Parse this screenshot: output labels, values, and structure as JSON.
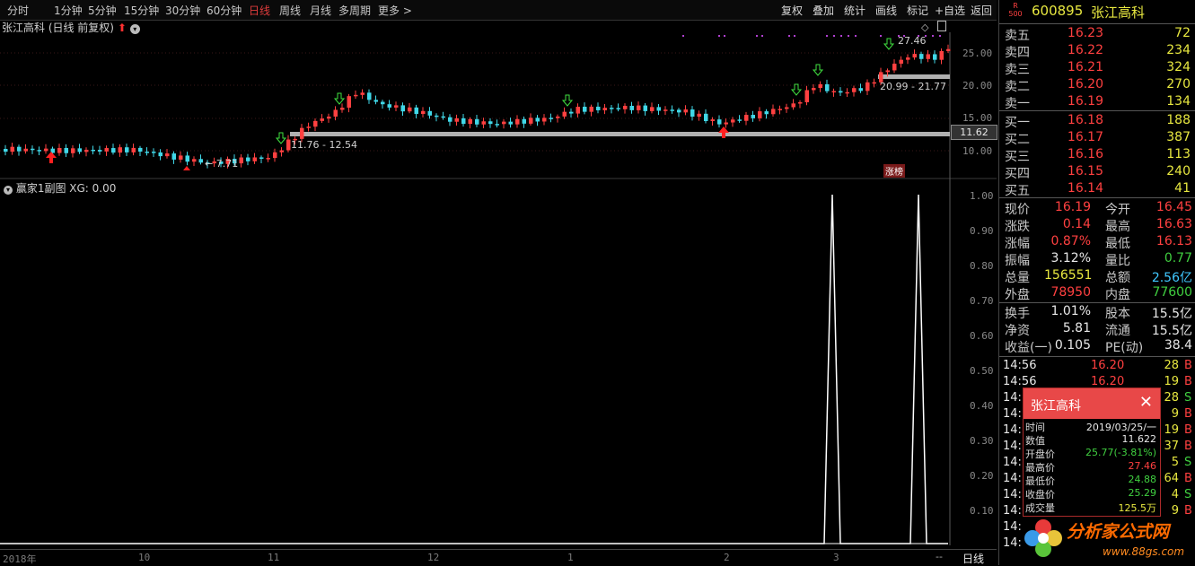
{
  "toolbar": {
    "periods": [
      "分时",
      "1分钟",
      "5分钟",
      "15分钟",
      "30分钟",
      "60分钟",
      "日线",
      "周线",
      "月线",
      "多周期",
      "更多 >"
    ],
    "active_period": "日线",
    "right_buttons": [
      "复权",
      "叠加",
      "统计",
      "画线",
      "标记",
      "+自选",
      "返回"
    ]
  },
  "chart": {
    "title": "张江高科 (日线 前复权)",
    "price_axis": [
      "25.00",
      "20.00",
      "15.00",
      "10.00"
    ],
    "current_price_tag": "11.62",
    "annotations": {
      "high_label": "27.46",
      "low_label": "7.71",
      "range1": "11.76 - 12.54",
      "range2": "20.99 - 21.77",
      "badge": "涨榜"
    },
    "sub_title": "赢家1副图  XG: 0.00",
    "sub_axis": [
      "1.00",
      "0.90",
      "0.80",
      "0.70",
      "0.60",
      "0.50",
      "0.40",
      "0.30",
      "0.20",
      "0.10"
    ],
    "time_axis": [
      "2018年",
      "10",
      "11",
      "12",
      "1",
      "2",
      "3"
    ],
    "period_label": "日线",
    "scroll_glyph": "--"
  },
  "chart_data": {
    "type": "line",
    "title": "",
    "series": [
      {
        "name": "XG",
        "x_fraction": [
          0.0,
          0.96,
          0.965,
          0.975,
          0.985,
          0.995,
          1.0
        ],
        "values": [
          0,
          0,
          1,
          0,
          0,
          1,
          0
        ]
      }
    ],
    "ylim": [
      0,
      1.0
    ]
  },
  "quote": {
    "code": "600895",
    "name": "张江高科",
    "badge_top": "R",
    "badge_bottom": "500",
    "asks": [
      {
        "label": "卖五",
        "price": "16.23",
        "vol": "72"
      },
      {
        "label": "卖四",
        "price": "16.22",
        "vol": "234"
      },
      {
        "label": "卖三",
        "price": "16.21",
        "vol": "324"
      },
      {
        "label": "卖二",
        "price": "16.20",
        "vol": "270"
      },
      {
        "label": "卖一",
        "price": "16.19",
        "vol": "134"
      }
    ],
    "bids": [
      {
        "label": "买一",
        "price": "16.18",
        "vol": "188"
      },
      {
        "label": "买二",
        "price": "16.17",
        "vol": "387"
      },
      {
        "label": "买三",
        "price": "16.16",
        "vol": "113"
      },
      {
        "label": "买四",
        "price": "16.15",
        "vol": "240"
      },
      {
        "label": "买五",
        "price": "16.14",
        "vol": "41"
      }
    ],
    "stats": [
      {
        "k1": "现价",
        "v1": "16.19",
        "c1": "red",
        "k2": "今开",
        "v2": "16.45",
        "c2": "red"
      },
      {
        "k1": "涨跌",
        "v1": "0.14",
        "c1": "red",
        "k2": "最高",
        "v2": "16.63",
        "c2": "red"
      },
      {
        "k1": "涨幅",
        "v1": "0.87%",
        "c1": "red",
        "k2": "最低",
        "v2": "16.13",
        "c2": "red"
      },
      {
        "k1": "振幅",
        "v1": "3.12%",
        "c1": "white",
        "k2": "量比",
        "v2": "0.77",
        "c2": "green"
      },
      {
        "k1": "总量",
        "v1": "156551",
        "c1": "yellow",
        "k2": "总额",
        "v2": "2.56亿",
        "c2": "cyan"
      },
      {
        "k1": "外盘",
        "v1": "78950",
        "c1": "red",
        "k2": "内盘",
        "v2": "77600",
        "c2": "green"
      }
    ],
    "fundamentals": [
      {
        "k1": "换手",
        "v1": "1.01%",
        "k2": "股本",
        "v2": "15.5亿"
      },
      {
        "k1": "净资",
        "v1": "5.81",
        "k2": "流通",
        "v2": "15.5亿"
      },
      {
        "k1": "收益(一)",
        "v1": "0.105",
        "k2": "PE(动)",
        "v2": "38.4"
      }
    ],
    "ticks": [
      {
        "t": "14:56",
        "p": "16.20",
        "v": "28",
        "bs": "B"
      },
      {
        "t": "14:56",
        "p": "16.20",
        "v": "19",
        "bs": "B"
      },
      {
        "t": "14:",
        "p": "",
        "v": "28",
        "bs": "S"
      },
      {
        "t": "14:",
        "p": "",
        "v": "9",
        "bs": "B"
      },
      {
        "t": "14:",
        "p": "",
        "v": "19",
        "bs": "B"
      },
      {
        "t": "14:",
        "p": "",
        "v": "37",
        "bs": "B"
      },
      {
        "t": "14:",
        "p": "",
        "v": "5",
        "bs": "S"
      },
      {
        "t": "14:",
        "p": "",
        "v": "64",
        "bs": "B"
      },
      {
        "t": "14:",
        "p": "",
        "v": "4",
        "bs": "S"
      },
      {
        "t": "14:",
        "p": "",
        "v": "9",
        "bs": "B"
      },
      {
        "t": "14:",
        "p": "",
        "v": "",
        "bs": ""
      },
      {
        "t": "14:",
        "p": "",
        "v": "",
        "bs": ""
      }
    ]
  },
  "popup": {
    "title": "张江高科",
    "close": "✕",
    "rows": [
      {
        "k": "时间",
        "v": "2019/03/25/一",
        "c": "white"
      },
      {
        "k": "数值",
        "v": "11.622",
        "c": "white"
      },
      {
        "k": "开盘价",
        "v": "25.77(-3.81%)",
        "c": "green"
      },
      {
        "k": "最高价",
        "v": "27.46",
        "c": "red"
      },
      {
        "k": "最低价",
        "v": "24.88",
        "c": "green"
      },
      {
        "k": "收盘价",
        "v": "25.29",
        "c": "green"
      },
      {
        "k": "成交量",
        "v": "125.5万",
        "c": "yellow"
      }
    ]
  },
  "logo": {
    "text": "分析家公式网",
    "url_text": "www.88gs.com"
  },
  "colors": {
    "up": "#ff4040",
    "down": "#40d8e8",
    "background": "#000000",
    "accent": "#e84848"
  }
}
